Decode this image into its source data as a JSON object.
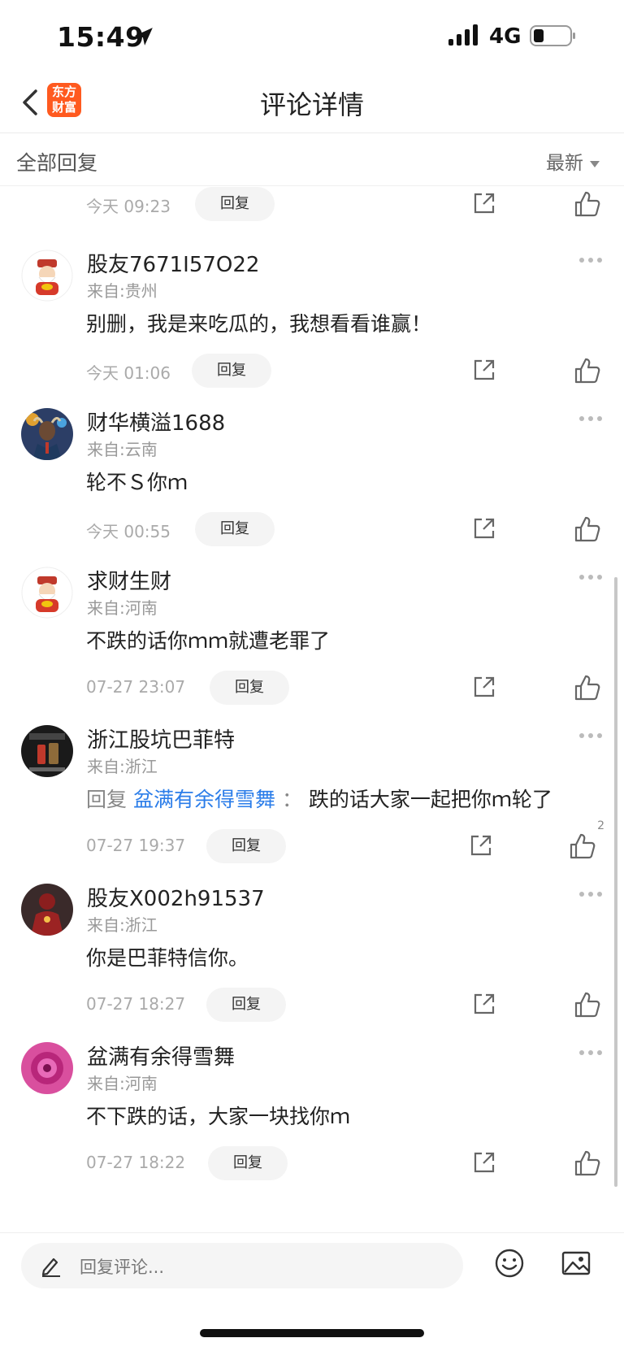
{
  "status_bar": {
    "time": "15:49",
    "network": "4G"
  },
  "nav": {
    "title": "评论详情",
    "logo_line1": "东方",
    "logo_line2": "财富",
    "brand_color": "#ff5a1f"
  },
  "filter": {
    "title": "全部回复",
    "sort": "最新"
  },
  "reply_label": "回复",
  "comments": [
    {
      "username": "",
      "location": "",
      "text": "",
      "time": "今天 09:23",
      "likes": ""
    },
    {
      "username": "股友7671I57O22",
      "location": "来自:贵州",
      "text": "别删，我是来吃瓜的，我想看看谁赢！",
      "time": "今天 01:06",
      "likes": "",
      "avatar": "fortune-god-icon"
    },
    {
      "username": "财华横溢1688",
      "location": "来自:云南",
      "text": "轮不Ｓ你ｍ",
      "time": "今天 00:55",
      "likes": "",
      "avatar": "bull-icon"
    },
    {
      "username": "求财生财",
      "location": "来自:河南",
      "text": "不跌的话你ｍｍ就遭老罪了",
      "time": "07-27 23:07",
      "likes": "",
      "avatar": "fortune-god-icon"
    },
    {
      "username": "浙江股坑巴菲特",
      "location": "来自:浙江",
      "reply_prefix": "回复",
      "reply_target": "盆满有余得雪舞",
      "reply_colon": "：",
      "text": "跌的话大家一起把你ｍ轮了",
      "time": "07-27 19:37",
      "likes": "2",
      "avatar": "poster-icon"
    },
    {
      "username": "股友X002h91537",
      "location": "来自:浙江",
      "text": "你是巴菲特信你。",
      "time": "07-27 18:27",
      "likes": "",
      "avatar": "ironman-icon"
    },
    {
      "username": "盆满有余得雪舞",
      "location": "来自:河南",
      "text": "不下跌的话，大家一块找你ｍ",
      "time": "07-27 18:22",
      "likes": "",
      "avatar": "pink-flower-icon"
    }
  ],
  "input": {
    "placeholder": "回复评论..."
  },
  "colors": {
    "link": "#2b7de9",
    "muted": "#999999"
  }
}
